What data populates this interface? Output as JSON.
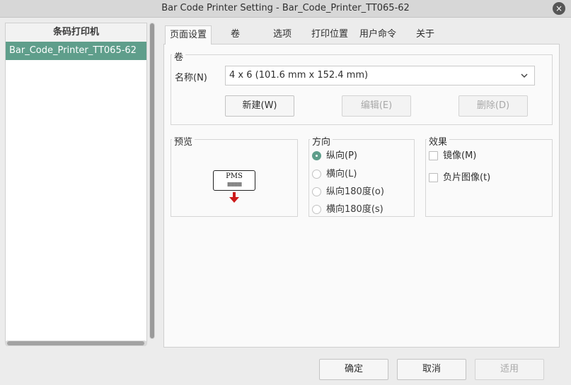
{
  "window": {
    "title": "Bar Code Printer Setting - Bar_Code_Printer_TT065-62",
    "close_glyph": "×"
  },
  "sidebar": {
    "header": "条码打印机",
    "items": [
      {
        "label": "Bar_Code_Printer_TT065-62",
        "selected": true
      }
    ]
  },
  "tabs": [
    {
      "label": "页面设置",
      "active": true
    },
    {
      "label": "卷"
    },
    {
      "label": "选项"
    },
    {
      "label": "打印位置"
    },
    {
      "label": "用户命令"
    },
    {
      "label": "关于"
    }
  ],
  "roll_group": {
    "title": "卷",
    "name_label": "名称(N)",
    "name_value": "4 x 6  (101.6 mm x 152.4 mm)",
    "new_button": "新建(W)",
    "edit_button": "编辑(E)",
    "delete_button": "删除(D)"
  },
  "preview_group": {
    "title": "预览",
    "label_text": "PMS"
  },
  "orientation_group": {
    "title": "方向",
    "options": [
      {
        "label": "纵向(P)",
        "selected": true
      },
      {
        "label": "横向(L)",
        "selected": false
      },
      {
        "label": "纵向180度(o)",
        "selected": false
      },
      {
        "label": "横向180度(s)",
        "selected": false
      }
    ]
  },
  "effects_group": {
    "title": "效果",
    "options": [
      {
        "label": "镜像(M)",
        "checked": false
      },
      {
        "label": "负片图像(t)",
        "checked": false
      }
    ]
  },
  "footer": {
    "ok": "确定",
    "cancel": "取消",
    "apply": "适用"
  },
  "colors": {
    "accent": "#5f9e8b",
    "arrow": "#cc1a1a"
  }
}
